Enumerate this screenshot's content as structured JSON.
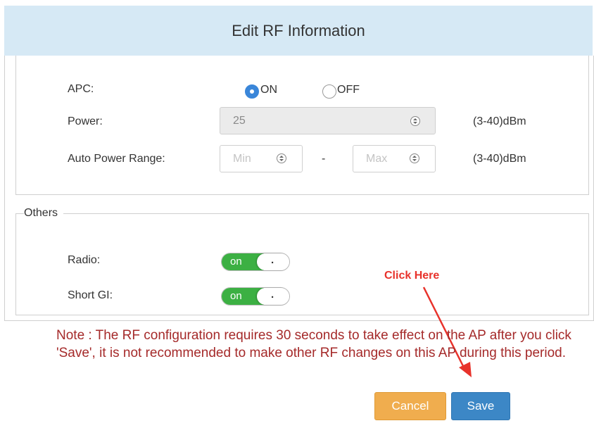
{
  "dialog": {
    "title": "Edit RF Information"
  },
  "apc": {
    "label": "APC:",
    "on_label": "ON",
    "off_label": "OFF",
    "selected": "ON"
  },
  "power": {
    "label": "Power:",
    "value": "25",
    "unit": "(3-40)dBm"
  },
  "auto_power_range": {
    "label": "Auto Power Range:",
    "min_placeholder": "Min",
    "max_placeholder": "Max",
    "separator": "-",
    "unit": "(3-40)dBm"
  },
  "others": {
    "legend": "Others",
    "radio": {
      "label": "Radio:",
      "state": "on"
    },
    "short_gi": {
      "label": "Short GI:",
      "state": "on"
    },
    "toggle_knob": "."
  },
  "note": "Note : The RF configuration requires 30 seconds to take effect on the AP after you click 'Save', it is not recommended to make other RF changes on this AP during this period.",
  "annotation": {
    "text": "Click Here",
    "color": "#e8322b"
  },
  "buttons": {
    "cancel": "Cancel",
    "save": "Save"
  },
  "colors": {
    "header_bg": "#d6e9f5",
    "toggle_on": "#3cb043",
    "cancel": "#f0ad4e",
    "save": "#3c87c6",
    "note": "#a52a2a"
  }
}
